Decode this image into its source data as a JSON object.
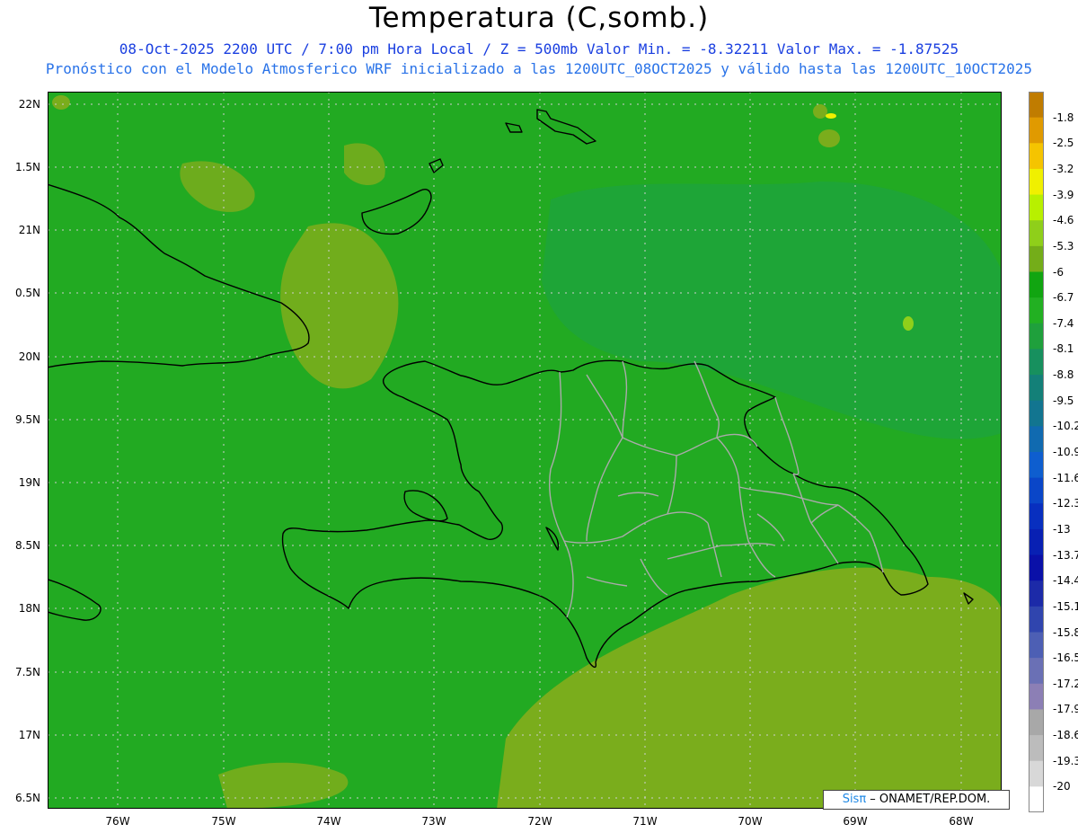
{
  "header": {
    "title": "Temperatura (C,somb.)",
    "line1": "08-Oct-2025  2200 UTC / 7:00 pm Hora Local / Z = 500mb  Valor Min. = -8.32211  Valor Max. = -1.87525",
    "line2": "Pronóstico con el Modelo Atmosferico WRF inicializado a las 1200UTC_08OCT2025 y válido hasta las  1200UTC_10OCT2025"
  },
  "map": {
    "lat_labels": [
      "22N",
      "1.5N",
      "21N",
      "0.5N",
      "20N",
      "9.5N",
      "19N",
      "8.5N",
      "18N",
      "7.5N",
      "17N",
      "6.5N"
    ],
    "lon_labels": [
      "76W",
      "75W",
      "74W",
      "73W",
      "72W",
      "71W",
      "70W",
      "69W",
      "68W"
    ],
    "lat_values": [
      22,
      21.5,
      21,
      20.5,
      20,
      19.5,
      19,
      18.5,
      18,
      17.5,
      17,
      16.5
    ],
    "lon_values": [
      -76,
      -75,
      -74,
      -73,
      -72,
      -71,
      -70,
      -69,
      -68
    ],
    "lat_range": [
      16.42,
      22.1
    ],
    "lon_range": [
      -76.65,
      -67.6
    ],
    "base_color": "#22aa22",
    "warm_color": "#7aad1c"
  },
  "colorbar": {
    "labels": [
      "-1.8",
      "-2.5",
      "-3.2",
      "-3.9",
      "-4.6",
      "-5.3",
      "-6",
      "-6.7",
      "-7.4",
      "-8.1",
      "-8.8",
      "-9.5",
      "-10.2",
      "-10.9",
      "-11.6",
      "-12.3",
      "-13",
      "-13.7",
      "-14.4",
      "-15.1",
      "-15.8",
      "-16.5",
      "-17.2",
      "-17.9",
      "-18.6",
      "-19.3",
      "-20"
    ],
    "colors": [
      "#c07c00",
      "#e09a00",
      "#f5c400",
      "#f0f000",
      "#b8f000",
      "#8fcf1a",
      "#74ad19",
      "#11a511",
      "#22b022",
      "#1fa03c",
      "#17905e",
      "#138078",
      "#127590",
      "#106ab0",
      "#0e5ecf",
      "#0a46c8",
      "#082fbf",
      "#0820b3",
      "#0a10a8",
      "#1c2aa8",
      "#3045ae",
      "#4d5fb4",
      "#6a70b5",
      "#8c7fb5",
      "#a8a8a8",
      "#bcbcbc",
      "#d8d8d8",
      "#ffffff"
    ]
  },
  "credit": {
    "brand": "Sisπ",
    "text": " – ONAMET/REP.DOM."
  }
}
